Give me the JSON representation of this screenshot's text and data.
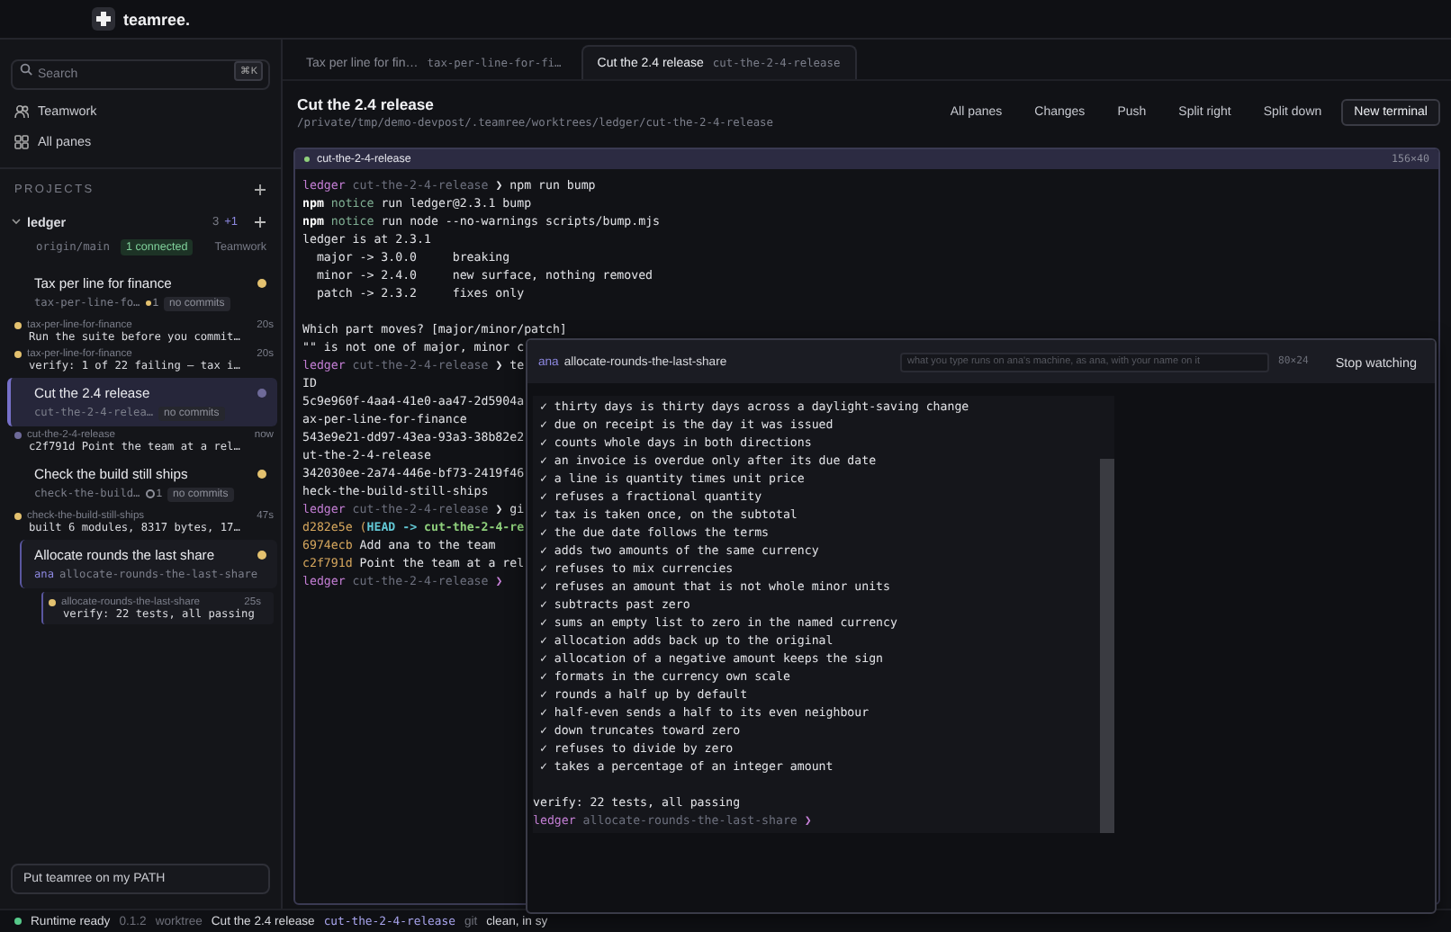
{
  "app": {
    "name": "teamree."
  },
  "sidebar": {
    "search": {
      "placeholder": "Search",
      "shortcut": "⌘K"
    },
    "nav": [
      {
        "label": "Teamwork",
        "kind": "people"
      },
      {
        "label": "All panes",
        "kind": "grid"
      }
    ],
    "projects_heading": "PROJECTS",
    "project": {
      "name": "ledger",
      "expanded": true,
      "count": "3",
      "extra": "+1",
      "remote": "origin/main",
      "connected": "1 connected",
      "teamwork": "Teamwork",
      "worktrees": [
        {
          "kind": "own",
          "title": "Tax per line for finance",
          "branch": "tax-per-line-fo…",
          "ahead": {
            "count": "1",
            "kind": "filled"
          },
          "badge": "no commits",
          "color": "#e3c16f",
          "selected": false,
          "activity": [
            {
              "branch": "tax-per-line-for-finance",
              "time": "20s",
              "text": "Run the suite before you commit…",
              "color": "#e3c16f"
            },
            {
              "branch": "tax-per-line-for-finance",
              "time": "20s",
              "text": "verify: 1 of 22 failing — tax i…",
              "color": "#e3c16f"
            }
          ]
        },
        {
          "kind": "own",
          "title": "Cut the 2.4 release",
          "branch": "cut-the-2-4-relea…",
          "badge": "no commits",
          "color": "#6e6a99",
          "selected": true,
          "activity": [
            {
              "branch": "cut-the-2-4-release",
              "time": "now",
              "text": "c2f791d Point the team at a rel…",
              "color": "#6e6a99"
            }
          ]
        },
        {
          "kind": "own",
          "title": "Check the build still ships",
          "branch": "check-the-build…",
          "ahead": {
            "count": "1",
            "kind": "hollow"
          },
          "badge": "no commits",
          "color": "#e3c16f",
          "selected": false,
          "activity": [
            {
              "branch": "check-the-build-still-ships",
              "time": "47s",
              "text": "built 6 modules, 8317 bytes, 17…",
              "color": "#e3c16f"
            }
          ]
        },
        {
          "kind": "teammate",
          "title": "Allocate rounds the last share",
          "owner": "ana",
          "branch": "allocate-rounds-the-last-share",
          "color": "#e3c16f",
          "selected": false,
          "activity": [
            {
              "branch": "allocate-rounds-the-last-share",
              "time": "25s",
              "text": "verify: 22 tests, all passing",
              "color": "#e3c16f"
            }
          ]
        }
      ]
    },
    "path_button": "Put teamree on my PATH"
  },
  "tabs": [
    {
      "title": "Tax per line for fin…",
      "branch": "tax-per-line-for-fi…",
      "selected": false
    },
    {
      "title": "Cut the 2.4 release",
      "branch": "cut-the-2-4-release",
      "selected": true
    }
  ],
  "header": {
    "title": "Cut the 2.4 release",
    "path": "/private/tmp/demo-devpost/.teamree/worktrees/ledger/cut-the-2-4-release",
    "actions": [
      {
        "label": "All panes",
        "kind": "plain"
      },
      {
        "label": "Changes",
        "kind": "plain"
      },
      {
        "label": "Push",
        "kind": "plain"
      },
      {
        "label": "Split right",
        "kind": "plain"
      },
      {
        "label": "Split down",
        "kind": "plain"
      },
      {
        "label": "New terminal",
        "kind": "outlined"
      }
    ]
  },
  "pane": {
    "branch": "cut-the-2-4-release",
    "size": "156×40",
    "lines": [
      {
        "parts": [
          {
            "text": "ledger ",
            "kind": "repo"
          },
          {
            "text": "cut-the-2-4-release ",
            "kind": "branch"
          },
          {
            "text": "❯ npm run bump",
            "kind": "plain"
          }
        ]
      },
      {
        "parts": [
          {
            "text": "npm ",
            "kind": "bold"
          },
          {
            "text": "notice ",
            "kind": "notice"
          },
          {
            "text": "run ledger@2.3.1 bump",
            "kind": "plain"
          }
        ]
      },
      {
        "parts": [
          {
            "text": "npm ",
            "kind": "bold"
          },
          {
            "text": "notice ",
            "kind": "notice"
          },
          {
            "text": "run node --no-warnings scripts/bump.mjs",
            "kind": "plain"
          }
        ]
      },
      {
        "parts": [
          {
            "text": "ledger is at 2.3.1",
            "kind": "plain"
          }
        ]
      },
      {
        "parts": [
          {
            "text": "  major -> 3.0.0     breaking",
            "kind": "plain"
          }
        ]
      },
      {
        "parts": [
          {
            "text": "  minor -> 2.4.0     new surface, nothing removed",
            "kind": "plain"
          }
        ]
      },
      {
        "parts": [
          {
            "text": "  patch -> 2.3.2     fixes only",
            "kind": "plain"
          }
        ]
      },
      {
        "gap": true,
        "parts": [
          {
            "text": "Which part moves? [major/minor/patch]",
            "kind": "plain"
          }
        ]
      },
      {
        "parts": [
          {
            "text": "\"\" is not one of major, minor c",
            "kind": "plain"
          }
        ]
      },
      {
        "parts": [
          {
            "text": "ledger ",
            "kind": "repo"
          },
          {
            "text": "cut-the-2-4-release ",
            "kind": "branch"
          },
          {
            "text": "❯ te",
            "kind": "plain"
          }
        ]
      },
      {
        "parts": [
          {
            "text": "ID",
            "kind": "plain"
          }
        ]
      },
      {
        "parts": [
          {
            "text": "5c9e960f-4aa4-41e0-aa47-2d5904a",
            "kind": "plain"
          }
        ]
      },
      {
        "parts": [
          {
            "text": "ax-per-line-for-finance",
            "kind": "plain"
          }
        ]
      },
      {
        "parts": [
          {
            "text": "543e9e21-dd97-43ea-93a3-38b82e2",
            "kind": "plain"
          }
        ]
      },
      {
        "parts": [
          {
            "text": "ut-the-2-4-release",
            "kind": "plain"
          }
        ]
      },
      {
        "parts": [
          {
            "text": "342030ee-2a74-446e-bf73-2419f46",
            "kind": "plain"
          }
        ]
      },
      {
        "parts": [
          {
            "text": "heck-the-build-still-ships",
            "kind": "plain"
          }
        ]
      },
      {
        "parts": [
          {
            "text": "ledger ",
            "kind": "repo"
          },
          {
            "text": "cut-the-2-4-release ",
            "kind": "branch"
          },
          {
            "text": "❯ gi",
            "kind": "plain"
          }
        ]
      },
      {
        "parts": [
          {
            "text": "d282e5e ",
            "kind": "hash"
          },
          {
            "text": "(",
            "kind": "hash"
          },
          {
            "text": "HEAD -> ",
            "kind": "head"
          },
          {
            "text": "cut-the-2-4-re",
            "kind": "ref"
          }
        ]
      },
      {
        "parts": [
          {
            "text": "6974ecb ",
            "kind": "hash"
          },
          {
            "text": "Add ana to the team",
            "kind": "plain"
          }
        ]
      },
      {
        "parts": [
          {
            "text": "c2f791d ",
            "kind": "hash"
          },
          {
            "text": "Point the team at a rel",
            "kind": "plain"
          }
        ]
      },
      {
        "parts": [
          {
            "text": "ledger ",
            "kind": "repo"
          },
          {
            "text": "cut-the-2-4-release ",
            "kind": "branch"
          },
          {
            "text": "❯",
            "kind": "repo"
          }
        ]
      }
    ]
  },
  "watch": {
    "owner": "ana",
    "branch": "allocate-rounds-the-last-share",
    "placeholder": "what you type runs on ana's machine, as ana, with your name on it",
    "size": "80×24",
    "button": "Stop watching",
    "lines": [
      {
        "parts": [
          {
            "text": " ✓ thirty days is thirty days across a daylight-saving change",
            "kind": "plain"
          }
        ]
      },
      {
        "parts": [
          {
            "text": " ✓ due on receipt is the day it was issued",
            "kind": "plain"
          }
        ]
      },
      {
        "parts": [
          {
            "text": " ✓ counts whole days in both directions",
            "kind": "plain"
          }
        ]
      },
      {
        "parts": [
          {
            "text": " ✓ an invoice is overdue only after its due date",
            "kind": "plain"
          }
        ]
      },
      {
        "parts": [
          {
            "text": " ✓ a line is quantity times unit price",
            "kind": "plain"
          }
        ]
      },
      {
        "parts": [
          {
            "text": " ✓ refuses a fractional quantity",
            "kind": "plain"
          }
        ]
      },
      {
        "parts": [
          {
            "text": " ✓ tax is taken once, on the subtotal",
            "kind": "plain"
          }
        ]
      },
      {
        "parts": [
          {
            "text": " ✓ the due date follows the terms",
            "kind": "plain"
          }
        ]
      },
      {
        "parts": [
          {
            "text": " ✓ adds two amounts of the same currency",
            "kind": "plain"
          }
        ]
      },
      {
        "parts": [
          {
            "text": " ✓ refuses to mix currencies",
            "kind": "plain"
          }
        ]
      },
      {
        "parts": [
          {
            "text": " ✓ refuses an amount that is not whole minor units",
            "kind": "plain"
          }
        ]
      },
      {
        "parts": [
          {
            "text": " ✓ subtracts past zero",
            "kind": "plain"
          }
        ]
      },
      {
        "parts": [
          {
            "text": " ✓ sums an empty list to zero in the named currency",
            "kind": "plain"
          }
        ]
      },
      {
        "parts": [
          {
            "text": " ✓ allocation adds back up to the original",
            "kind": "plain"
          }
        ]
      },
      {
        "parts": [
          {
            "text": " ✓ allocation of a negative amount keeps the sign",
            "kind": "plain"
          }
        ]
      },
      {
        "parts": [
          {
            "text": " ✓ formats in the currency own scale",
            "kind": "plain"
          }
        ]
      },
      {
        "parts": [
          {
            "text": " ✓ rounds a half up by default",
            "kind": "plain"
          }
        ]
      },
      {
        "parts": [
          {
            "text": " ✓ half-even sends a half to its even neighbour",
            "kind": "plain"
          }
        ]
      },
      {
        "parts": [
          {
            "text": " ✓ down truncates toward zero",
            "kind": "plain"
          }
        ]
      },
      {
        "parts": [
          {
            "text": " ✓ refuses to divide by zero",
            "kind": "plain"
          }
        ]
      },
      {
        "parts": [
          {
            "text": " ✓ takes a percentage of an integer amount",
            "kind": "plain"
          }
        ]
      },
      {
        "gap": true,
        "parts": [
          {
            "text": "verify: 22 tests, all passing",
            "kind": "plain"
          }
        ]
      },
      {
        "parts": [
          {
            "text": "ledger ",
            "kind": "repo"
          },
          {
            "text": "allocate-rounds-the-last-share ",
            "kind": "branch"
          },
          {
            "text": "❯",
            "kind": "repo"
          }
        ]
      }
    ]
  },
  "status_bar": {
    "ready": true,
    "label": "Runtime ready",
    "version": "0.1.2",
    "worktree_label": "worktree",
    "worktree": "Cut the 2.4 release",
    "branch": "cut-the-2-4-release",
    "git_label": "git",
    "git": "clean, in sy"
  }
}
